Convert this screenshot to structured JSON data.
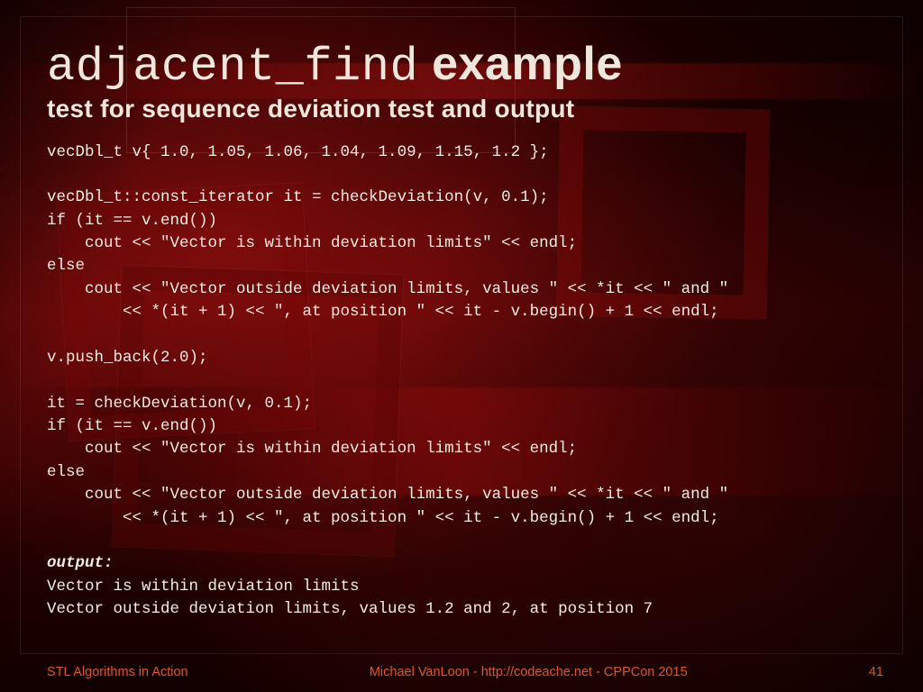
{
  "title": {
    "mono": "adjacent_find",
    "rest": " example"
  },
  "subtitle": "test for sequence deviation test and output",
  "code": "vecDbl_t v{ 1.0, 1.05, 1.06, 1.04, 1.09, 1.15, 1.2 };\n\nvecDbl_t::const_iterator it = checkDeviation(v, 0.1);\nif (it == v.end())\n    cout << \"Vector is within deviation limits\" << endl;\nelse\n    cout << \"Vector outside deviation limits, values \" << *it << \" and \"\n        << *(it + 1) << \", at position \" << it - v.begin() + 1 << endl;\n\nv.push_back(2.0);\n\nit = checkDeviation(v, 0.1);\nif (it == v.end())\n    cout << \"Vector is within deviation limits\" << endl;\nelse\n    cout << \"Vector outside deviation limits, values \" << *it << \" and \"\n        << *(it + 1) << \", at position \" << it - v.begin() + 1 << endl;",
  "output_label": "output:",
  "output_text": "Vector is within deviation limits\nVector outside deviation limits, values 1.2 and 2, at position 7",
  "footer": {
    "left": "STL Algorithms in Action",
    "center": "Michael VanLoon - http://codeache.net - CPPCon 2015",
    "page": "41"
  }
}
